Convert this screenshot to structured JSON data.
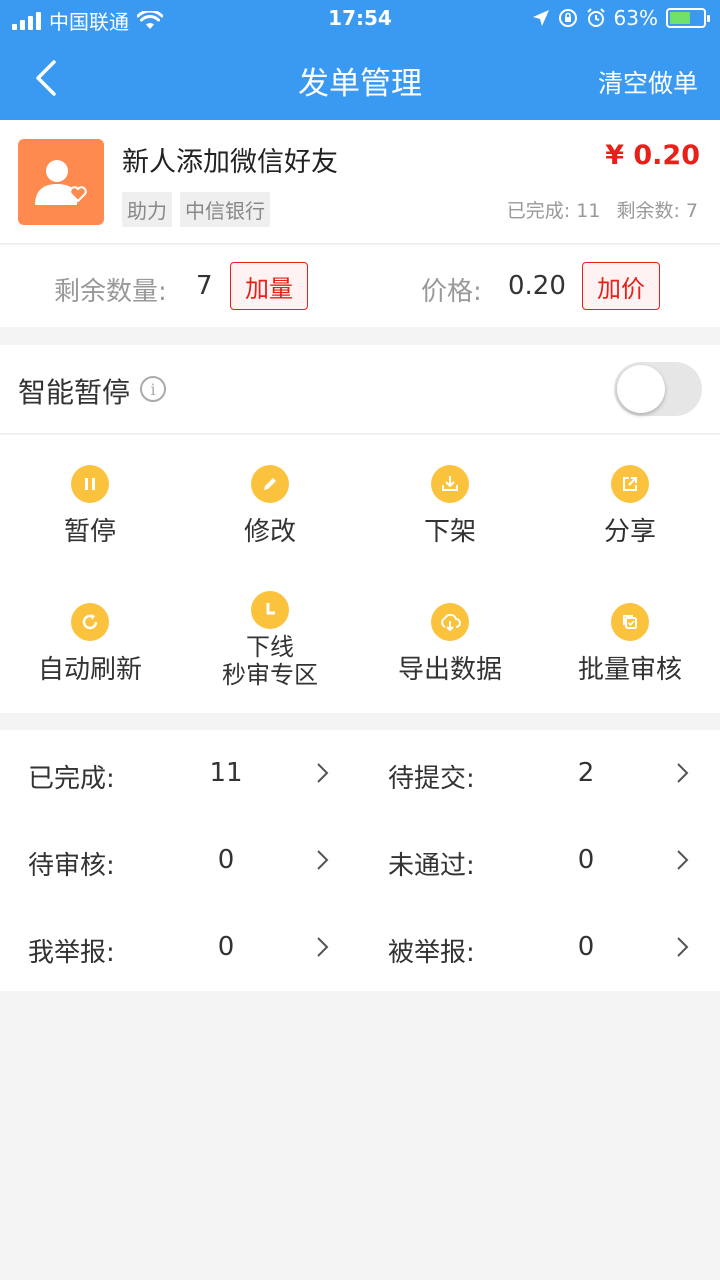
{
  "status_bar": {
    "carrier": "中国联通",
    "time": "17:54",
    "battery": "63%",
    "battery_level": 0.63
  },
  "nav": {
    "title": "发单管理",
    "action": "清空做单"
  },
  "task": {
    "title": "新人添加微信好友",
    "price": "¥ 0.20",
    "tags": [
      "助力",
      "中信银行"
    ],
    "completed": "已完成: 11",
    "remaining": "剩余数: 7"
  },
  "quantity": {
    "remaining_label": "剩余数量:",
    "remaining_value": "7",
    "add_qty_label": "加量",
    "price_label": "价格:",
    "price_value": "0.20",
    "add_price_label": "加价"
  },
  "smart_pause": {
    "label": "智能暂停",
    "enabled": false
  },
  "actions": [
    {
      "label": "暂停",
      "icon": "pause-icon"
    },
    {
      "label": "修改",
      "icon": "pencil-icon"
    },
    {
      "label": "下架",
      "icon": "download-tray-icon"
    },
    {
      "label": "分享",
      "icon": "share-icon"
    },
    {
      "label": "自动刷新",
      "icon": "refresh-icon"
    },
    {
      "label_line1": "下线",
      "label_line2": "秒审专区",
      "icon": "clock-icon"
    },
    {
      "label": "导出数据",
      "icon": "cloud-download-icon"
    },
    {
      "label": "批量审核",
      "icon": "batch-review-icon"
    }
  ],
  "stats": [
    {
      "label": "已完成:",
      "value": "11"
    },
    {
      "label": "待提交:",
      "value": "2"
    },
    {
      "label": "待审核:",
      "value": "0"
    },
    {
      "label": "未通过:",
      "value": "0"
    },
    {
      "label": "我举报:",
      "value": "0"
    },
    {
      "label": "被举报:",
      "value": "0"
    }
  ],
  "colors": {
    "header_blue": "#3a9af2",
    "price_red": "#e8201a",
    "icon_yellow": "#fbc23d",
    "avatar_orange": "#ff8a4f"
  }
}
